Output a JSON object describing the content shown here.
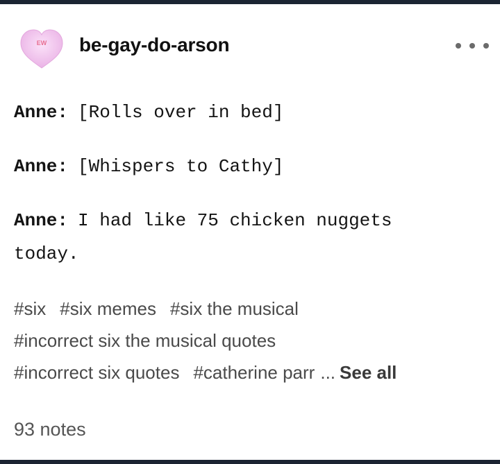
{
  "header": {
    "avatar_text": "EW",
    "username": "be-gay-do-arson",
    "more_icon": "more-horizontal-icon"
  },
  "post": {
    "lines": [
      {
        "speaker": "Anne:",
        "text": "[Rolls over in bed]"
      },
      {
        "speaker": "Anne:",
        "text": "[Whispers to Cathy]"
      },
      {
        "speaker": "Anne:",
        "text": "I had like 75 chicken nuggets",
        "continuation": "today."
      }
    ]
  },
  "tags": {
    "items": [
      "#six",
      "#six memes",
      "#six the musical",
      "#incorrect six the musical quotes",
      "#incorrect six quotes",
      "#catherine parr"
    ],
    "ellipsis": "...",
    "see_all": "See all"
  },
  "footer": {
    "notes": "93 notes"
  },
  "colors": {
    "avatar_heart": "#f5c9f0",
    "avatar_text": "#e86f92",
    "frame_border": "#1b2432"
  }
}
